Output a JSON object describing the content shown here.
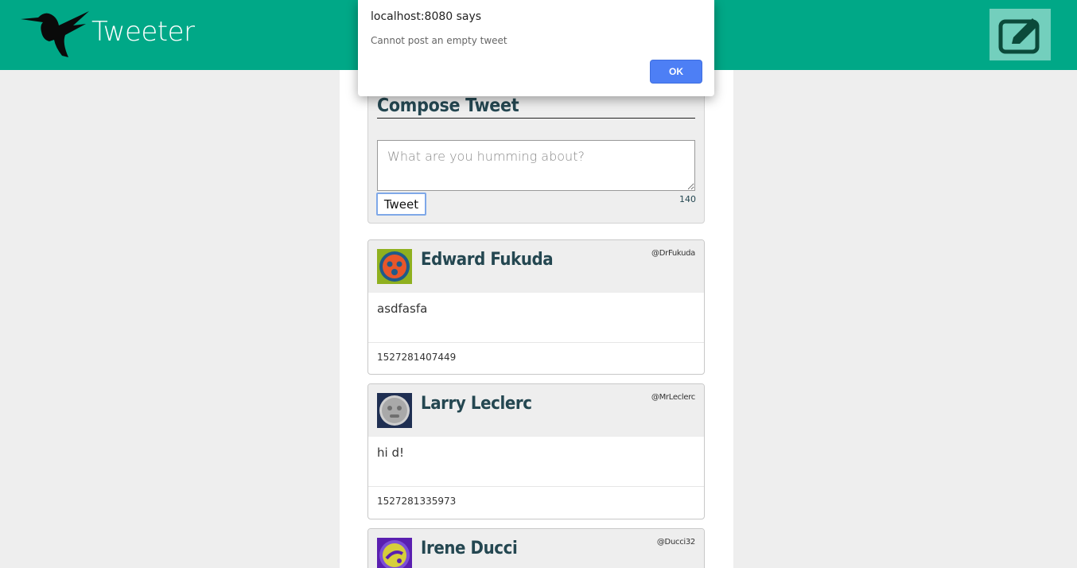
{
  "nav": {
    "brand": "Tweeter"
  },
  "compose": {
    "title": "Compose Tweet",
    "placeholder": "What are you humming about?",
    "button_label": "Tweet",
    "counter": "140"
  },
  "tweets": [
    {
      "name": "Edward Fukuda",
      "handle": "@DrFukuda",
      "content": "asdfasfa",
      "timestamp": "1527281407449",
      "avatar_colors": {
        "bg": "#8fb01f",
        "face": "#e8562a",
        "ring": "#1f5a8a"
      }
    },
    {
      "name": "Larry Leclerc",
      "handle": "@MrLeclerc",
      "content": "hi d!",
      "timestamp": "1527281335973",
      "avatar_colors": {
        "bg": "#1f2f52",
        "face": "#a9a9a9",
        "ring": "#cfcfcf"
      }
    },
    {
      "name": "Irene Ducci",
      "handle": "@Ducci32",
      "content": "",
      "timestamp": "",
      "avatar_colors": {
        "bg": "#5a1fb0",
        "face": "#d6cf3a",
        "ring": "#7d4fd6"
      }
    }
  ],
  "alert": {
    "title": "localhost:8080 says",
    "message": "Cannot post an empty tweet",
    "ok_label": "OK"
  },
  "colors": {
    "brand_green": "#00a887",
    "name_color": "#244751",
    "ok_blue": "#4d7ff5"
  },
  "icons": {
    "logo": "hummingbird-icon",
    "compose": "edit-pencil-icon"
  }
}
